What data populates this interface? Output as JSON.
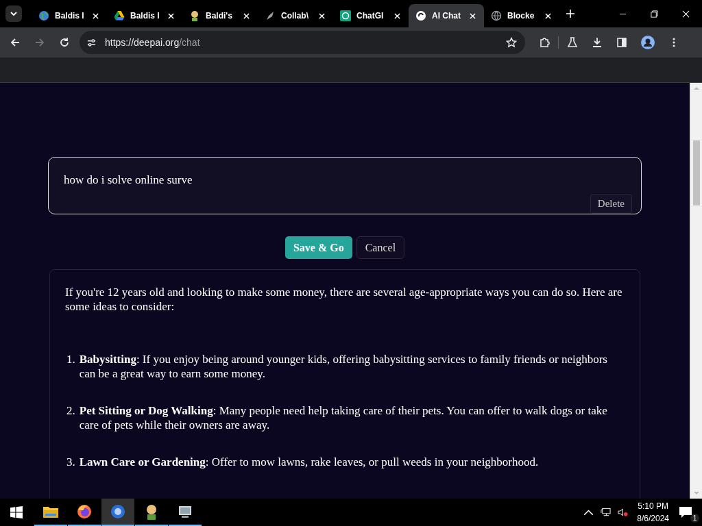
{
  "browser": {
    "tabs": [
      {
        "title": "Baldis I",
        "selected": false
      },
      {
        "title": "Baldis I",
        "selected": false
      },
      {
        "title": "Baldi's",
        "selected": false
      },
      {
        "title": "Collab\\",
        "selected": false
      },
      {
        "title": "ChatGI",
        "selected": false
      },
      {
        "title": "AI Chat",
        "selected": true
      },
      {
        "title": "Blocke",
        "selected": false
      }
    ],
    "url": {
      "host": "https://deepai.org",
      "path": "/chat"
    }
  },
  "chat": {
    "prompt": {
      "value": "how do i solve online surve",
      "delete": "Delete"
    },
    "buttons": {
      "save": "Save & Go",
      "cancel": "Cancel"
    },
    "response": {
      "intro": "If you're 12 years old and looking to make some money, there are several age-appropriate ways you can do so. Here are some ideas to consider:",
      "items": [
        {
          "number": "1.",
          "text": "**Babysitting**: If you enjoy being around younger kids, offering babysitting services to family friends or neighbors can be a great way to earn some money."
        },
        {
          "number": "2.",
          "text": "**Pet Sitting or Dog Walking**: Many people need help taking care of their pets. You can offer to walk dogs or take care of pets while their owners are away."
        },
        {
          "number": "3.",
          "text": "**Lawn Care or Gardening**: Offer to mow lawns, rake leaves, or pull weeds in your neighborhood."
        }
      ]
    }
  },
  "taskbar": {
    "apps": [
      {
        "selected": false
      },
      {
        "selected": false
      },
      {
        "selected": true
      },
      {
        "selected": false
      },
      {
        "selected": false
      }
    ],
    "time": "5:10 PM",
    "date": "8/6/2024",
    "notifications": "1"
  }
}
